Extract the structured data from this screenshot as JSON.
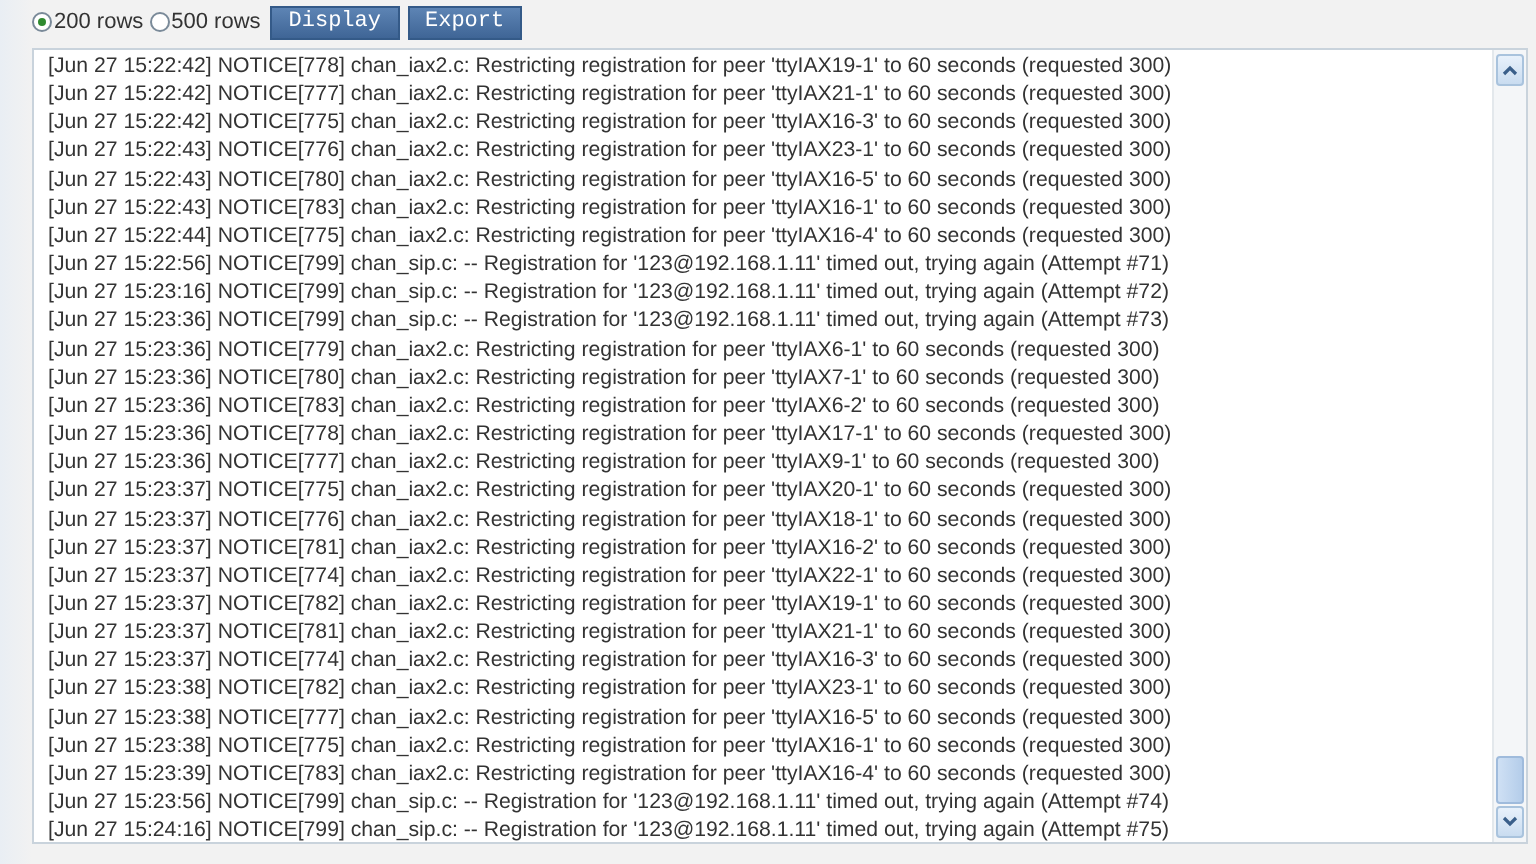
{
  "row_options": [
    {
      "label": "200 rows",
      "selected": true
    },
    {
      "label": "500 rows",
      "selected": false
    }
  ],
  "buttons": [
    "Display",
    "Export"
  ],
  "log_lines": [
    "[Jun 27 15:22:42] NOTICE[778] chan_iax2.c: Restricting registration for peer 'ttyIAX19-1' to 60 seconds (requested 300)",
    "[Jun 27 15:22:42] NOTICE[777] chan_iax2.c: Restricting registration for peer 'ttyIAX21-1' to 60 seconds (requested 300)",
    "[Jun 27 15:22:42] NOTICE[775] chan_iax2.c: Restricting registration for peer 'ttyIAX16-3' to 60 seconds (requested 300)",
    "[Jun 27 15:22:43] NOTICE[776] chan_iax2.c: Restricting registration for peer 'ttyIAX23-1' to 60 seconds (requested 300)",
    "[Jun 27 15:22:43] NOTICE[780] chan_iax2.c: Restricting registration for peer 'ttyIAX16-5' to 60 seconds (requested 300)",
    "[Jun 27 15:22:43] NOTICE[783] chan_iax2.c: Restricting registration for peer 'ttyIAX16-1' to 60 seconds (requested 300)",
    "[Jun 27 15:22:44] NOTICE[775] chan_iax2.c: Restricting registration for peer 'ttyIAX16-4' to 60 seconds (requested 300)",
    "[Jun 27 15:22:56] NOTICE[799] chan_sip.c: -- Registration for '123@192.168.1.11' timed out, trying again (Attempt #71)",
    "[Jun 27 15:23:16] NOTICE[799] chan_sip.c: -- Registration for '123@192.168.1.11' timed out, trying again (Attempt #72)",
    "[Jun 27 15:23:36] NOTICE[799] chan_sip.c: -- Registration for '123@192.168.1.11' timed out, trying again (Attempt #73)",
    "[Jun 27 15:23:36] NOTICE[779] chan_iax2.c: Restricting registration for peer 'ttyIAX6-1' to 60 seconds (requested 300)",
    "[Jun 27 15:23:36] NOTICE[780] chan_iax2.c: Restricting registration for peer 'ttyIAX7-1' to 60 seconds (requested 300)",
    "[Jun 27 15:23:36] NOTICE[783] chan_iax2.c: Restricting registration for peer 'ttyIAX6-2' to 60 seconds (requested 300)",
    "[Jun 27 15:23:36] NOTICE[778] chan_iax2.c: Restricting registration for peer 'ttyIAX17-1' to 60 seconds (requested 300)",
    "[Jun 27 15:23:36] NOTICE[777] chan_iax2.c: Restricting registration for peer 'ttyIAX9-1' to 60 seconds (requested 300)",
    "[Jun 27 15:23:37] NOTICE[775] chan_iax2.c: Restricting registration for peer 'ttyIAX20-1' to 60 seconds (requested 300)",
    "[Jun 27 15:23:37] NOTICE[776] chan_iax2.c: Restricting registration for peer 'ttyIAX18-1' to 60 seconds (requested 300)",
    "[Jun 27 15:23:37] NOTICE[781] chan_iax2.c: Restricting registration for peer 'ttyIAX16-2' to 60 seconds (requested 300)",
    "[Jun 27 15:23:37] NOTICE[774] chan_iax2.c: Restricting registration for peer 'ttyIAX22-1' to 60 seconds (requested 300)",
    "[Jun 27 15:23:37] NOTICE[782] chan_iax2.c: Restricting registration for peer 'ttyIAX19-1' to 60 seconds (requested 300)",
    "[Jun 27 15:23:37] NOTICE[781] chan_iax2.c: Restricting registration for peer 'ttyIAX21-1' to 60 seconds (requested 300)",
    "[Jun 27 15:23:37] NOTICE[774] chan_iax2.c: Restricting registration for peer 'ttyIAX16-3' to 60 seconds (requested 300)",
    "[Jun 27 15:23:38] NOTICE[782] chan_iax2.c: Restricting registration for peer 'ttyIAX23-1' to 60 seconds (requested 300)",
    "[Jun 27 15:23:38] NOTICE[777] chan_iax2.c: Restricting registration for peer 'ttyIAX16-5' to 60 seconds (requested 300)",
    "[Jun 27 15:23:38] NOTICE[775] chan_iax2.c: Restricting registration for peer 'ttyIAX16-1' to 60 seconds (requested 300)",
    "[Jun 27 15:23:39] NOTICE[783] chan_iax2.c: Restricting registration for peer 'ttyIAX16-4' to 60 seconds (requested 300)",
    "[Jun 27 15:23:56] NOTICE[799] chan_sip.c: -- Registration for '123@192.168.1.11' timed out, trying again (Attempt #74)",
    "[Jun 27 15:24:16] NOTICE[799] chan_sip.c: -- Registration for '123@192.168.1.11' timed out, trying again (Attempt #75)"
  ]
}
